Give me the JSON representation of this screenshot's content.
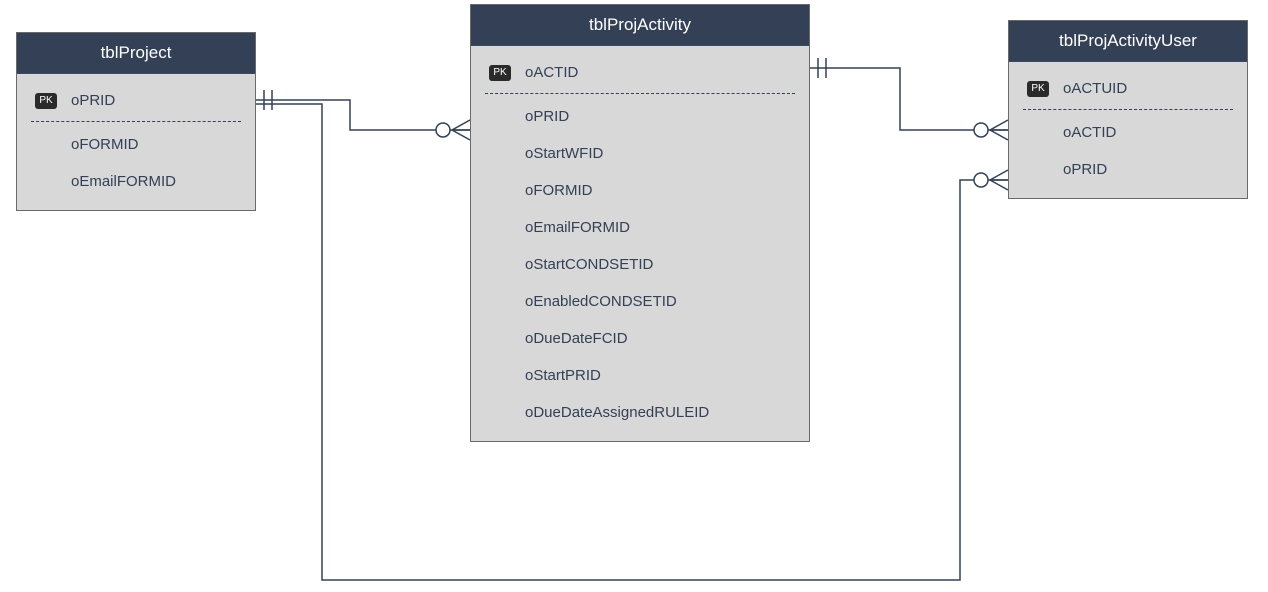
{
  "entities": {
    "project": {
      "title": "tblProject",
      "pkBadge": "PK",
      "columns": {
        "pk": "oPRID",
        "c1": "oFORMID",
        "c2": "oEmailFORMID"
      }
    },
    "activity": {
      "title": "tblProjActivity",
      "pkBadge": "PK",
      "columns": {
        "pk": "oACTID",
        "c1": "oPRID",
        "c2": "oStartWFID",
        "c3": "oFORMID",
        "c4": "oEmailFORMID",
        "c5": "oStartCONDSETID",
        "c6": "oEnabledCONDSETID",
        "c7": "oDueDateFCID",
        "c8": "oStartPRID",
        "c9": "oDueDateAssignedRULEID"
      }
    },
    "activityUser": {
      "title": "tblProjActivityUser",
      "pkBadge": "PK",
      "columns": {
        "pk": "oACTUID",
        "c1": "oACTID",
        "c2": "oPRID"
      }
    }
  },
  "relationships": [
    {
      "from": "project.oPRID",
      "to": "activity.oPRID",
      "type": "one-to-many"
    },
    {
      "from": "activity.oACTID",
      "to": "activityUser.oACTID",
      "type": "one-to-many"
    },
    {
      "from": "project.oPRID",
      "to": "activityUser.oPRID",
      "type": "one-to-many"
    }
  ],
  "colors": {
    "header": "#334055",
    "body": "#d8d8d8",
    "text": "#334055",
    "line": "#334055"
  }
}
